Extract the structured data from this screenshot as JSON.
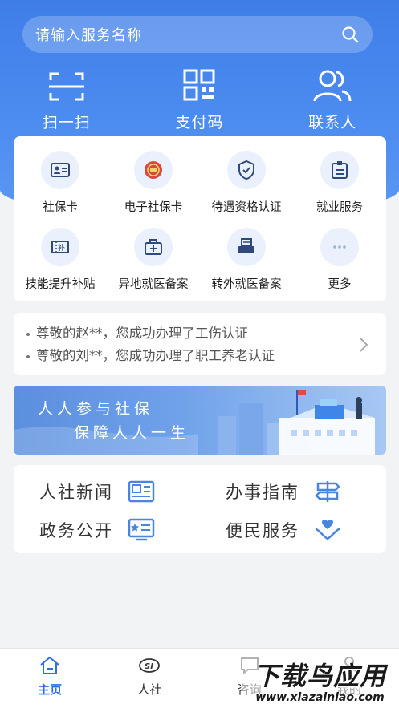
{
  "search": {
    "placeholder": "请输入服务名称"
  },
  "quick_actions": [
    {
      "label": "扫一扫",
      "icon": "scan-icon"
    },
    {
      "label": "支付码",
      "icon": "qrcode-icon"
    },
    {
      "label": "联系人",
      "icon": "contacts-icon"
    }
  ],
  "services": [
    {
      "label": "社保卡",
      "icon": "id-card-icon"
    },
    {
      "label": "电子社保卡",
      "icon": "emblem-icon"
    },
    {
      "label": "待遇资格认证",
      "icon": "shield-check-icon"
    },
    {
      "label": "就业服务",
      "icon": "badge-icon"
    },
    {
      "label": "技能提升补贴",
      "icon": "subsidy-ticket-icon"
    },
    {
      "label": "异地就医备案",
      "icon": "medical-kit-icon"
    },
    {
      "label": "转外就医备案",
      "icon": "printer-icon"
    },
    {
      "label": "更多",
      "icon": "more-icon"
    }
  ],
  "notices": [
    "尊敬的赵**，您成功办理了工伤认证",
    "尊敬的刘**，您成功办理了职工养老认证"
  ],
  "banner": {
    "line1": "人人参与社保",
    "line2": "保障人人一生"
  },
  "links": [
    {
      "label": "人社新闻",
      "icon": "news-icon"
    },
    {
      "label": "办事指南",
      "icon": "signpost-icon"
    },
    {
      "label": "政务公开",
      "icon": "bulletin-board-icon"
    },
    {
      "label": "便民服务",
      "icon": "heart-hands-icon"
    }
  ],
  "tabs": [
    {
      "label": "主页",
      "icon": "home-icon",
      "active": true
    },
    {
      "label": "人社",
      "icon": "si-logo-icon",
      "active": false
    },
    {
      "label": "咨询",
      "icon": "chat-icon",
      "active": false
    },
    {
      "label": "我的",
      "icon": "user-icon",
      "active": false
    }
  ],
  "watermark": {
    "line1": "下载鸟应用",
    "line2": "www.xiazainiao.com"
  },
  "colors": {
    "primary": "#3f7ee8",
    "icon_blue": "#2f6fe0",
    "icon_bg": "#eaf1fd"
  }
}
